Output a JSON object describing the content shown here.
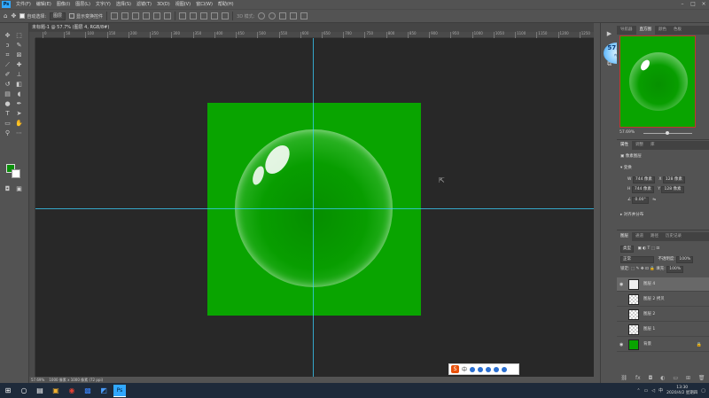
{
  "menubar": {
    "items": [
      "文件(F)",
      "编辑(E)",
      "图像(I)",
      "图层(L)",
      "文字(Y)",
      "选择(S)",
      "滤镜(T)",
      "3D(D)",
      "视图(V)",
      "窗口(W)",
      "帮助(H)"
    ],
    "logo": "Ps"
  },
  "options": {
    "autoselect_label": "自动选择:",
    "autoselect_value": "图层",
    "transform_label": "显示变换控件",
    "mode_3d_label": "3D 模式:"
  },
  "document": {
    "tab_title": "未标题-1 @ 57.7% (图层 4, RGB/8#) *",
    "status_zoom": "57.69%",
    "status_size": "1000 像素 x 1000 像素 (72 ppi)",
    "bg_color": "#09a400"
  },
  "ruler": {
    "labels": [
      "0",
      "50",
      "100",
      "150",
      "200",
      "250",
      "300",
      "350",
      "400",
      "450",
      "500",
      "550",
      "600",
      "650",
      "700",
      "750",
      "800",
      "850",
      "900",
      "950",
      "1000",
      "1050",
      "1100",
      "1150",
      "1200",
      "1250"
    ]
  },
  "speed_widget": {
    "value": "57.6",
    "unit": "%",
    "sub": "内存"
  },
  "navigator": {
    "tabs": [
      "导航器",
      "直方图",
      "颜色",
      "色板"
    ],
    "zoom": "57.69%"
  },
  "properties": {
    "tabs": [
      "属性",
      "调整",
      "库"
    ],
    "doc_label": "像素图层",
    "transform_title": "变换",
    "w_label": "W",
    "w_value": "744 像素",
    "h_label": "H",
    "h_value": "744 像素",
    "x_label": "X",
    "x_value": "128 像素",
    "y_label": "Y",
    "y_value": "128 像素",
    "angle_value": "0.00°",
    "align_title": "对齐并分布"
  },
  "layers": {
    "tabs": [
      "图层",
      "通道",
      "路径",
      "历史记录"
    ],
    "kind_label": "类型",
    "blend_mode": "正常",
    "opacity_label": "不透明度:",
    "opacity_value": "100%",
    "lock_label": "锁定:",
    "fill_label": "填充:",
    "fill_value": "100%",
    "items": [
      {
        "name": "图层 4",
        "visible": true,
        "selected": true
      },
      {
        "name": "图层 2 拷贝",
        "visible": false,
        "selected": false
      },
      {
        "name": "图层 2",
        "visible": false,
        "selected": false
      },
      {
        "name": "图层 1",
        "visible": false,
        "selected": false
      },
      {
        "name": "背景",
        "visible": true,
        "selected": false
      }
    ]
  },
  "taskbar": {
    "time": "13:30",
    "date": "2020/4/2 星期四",
    "lang": "中"
  }
}
